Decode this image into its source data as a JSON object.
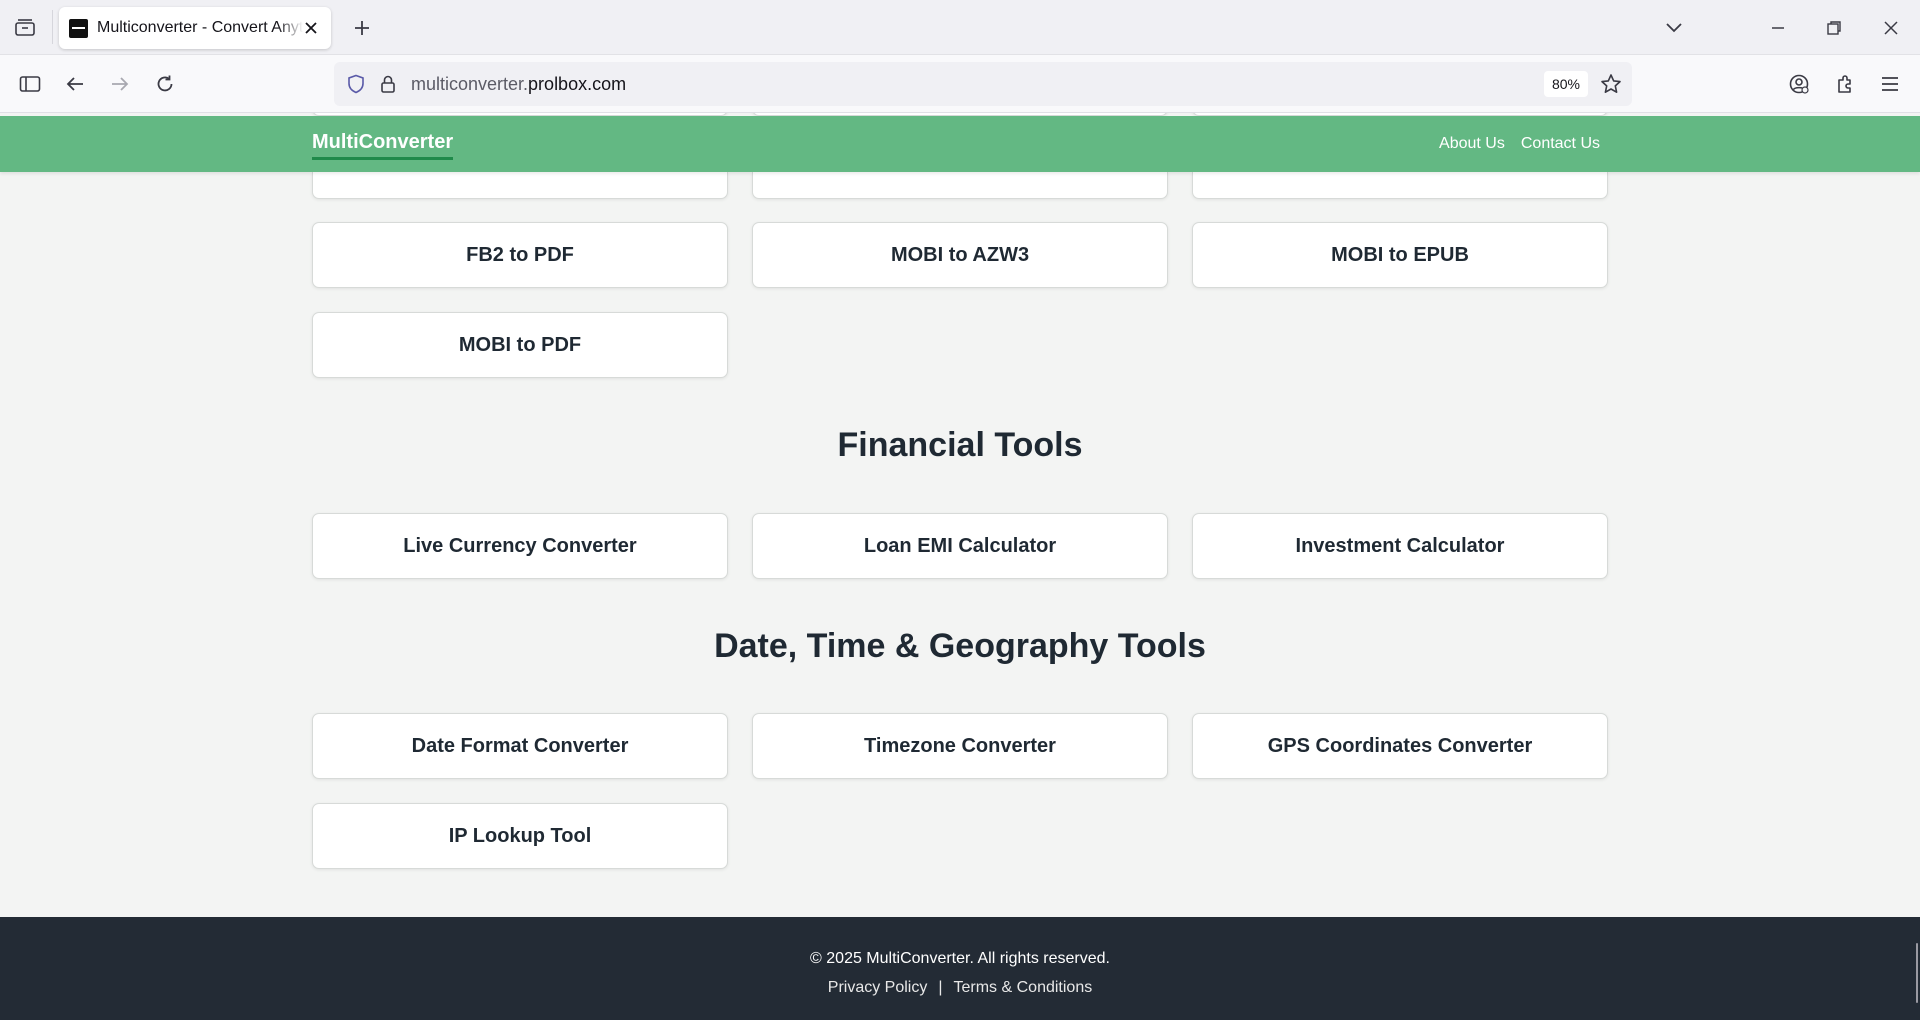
{
  "browser": {
    "tab_title": "Multiconverter - Convert Anything",
    "url_prefix": "multiconverter.",
    "url_host": "prolbox.com",
    "zoom": "80%"
  },
  "site": {
    "brand": "MultiConverter",
    "nav": [
      "About Us",
      "Contact Us"
    ]
  },
  "ebook_cards": [
    "FB2 to PDF",
    "MOBI to AZW3",
    "MOBI to EPUB",
    "MOBI to PDF"
  ],
  "financial": {
    "title": "Financial Tools",
    "cards": [
      "Live Currency Converter",
      "Loan EMI Calculator",
      "Investment Calculator"
    ]
  },
  "datetime": {
    "title": "Date, Time & Geography Tools",
    "cards": [
      "Date Format Converter",
      "Timezone Converter",
      "GPS Coordinates Converter",
      "IP Lookup Tool"
    ]
  },
  "footer": {
    "copyright": "© 2025 MultiConverter. All rights reserved.",
    "privacy": "Privacy Policy",
    "separator": "|",
    "terms": "Terms & Conditions"
  }
}
